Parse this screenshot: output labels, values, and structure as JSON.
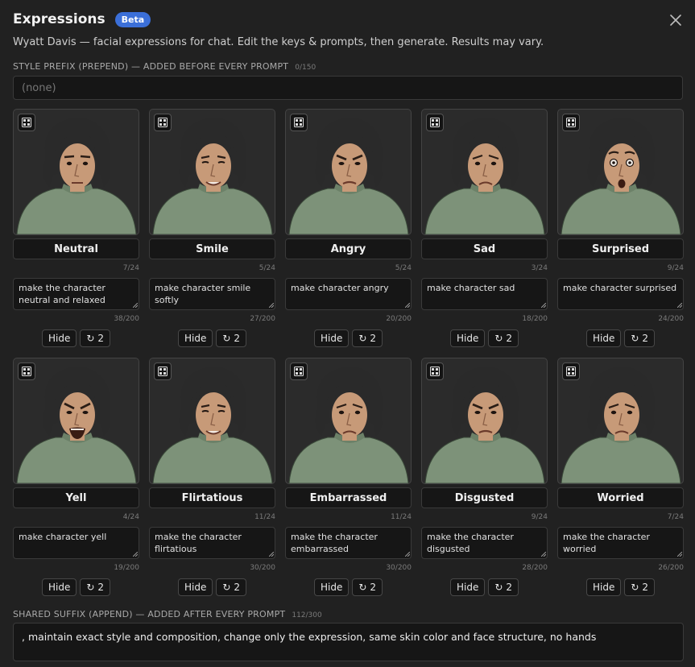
{
  "header": {
    "title": "Expressions",
    "badge": "Beta"
  },
  "subtitle": "Wyatt Davis — facial expressions for chat. Edit the keys & prompts, then generate. Results may vary.",
  "prefix": {
    "label": "STYLE PREFIX (PREPEND) — ADDED BEFORE EVERY PROMPT",
    "count": "0/150",
    "placeholder": "(none)",
    "value": ""
  },
  "suffix": {
    "label": "SHARED SUFFIX (APPEND) — ADDED AFTER EVERY PROMPT",
    "count": "112/300",
    "value": ", maintain exact style and composition, change only the expression, same skin color and face structure, no hands"
  },
  "buttons": {
    "hide": "Hide",
    "regen": "2"
  },
  "icons": {
    "close": "close-icon",
    "generate": "generate-icon",
    "regenerate": "refresh-icon",
    "resize": "resize-grip-icon"
  },
  "colors": {
    "background": "#212121",
    "badge": "#3b6fd8",
    "sweater": "#7d9279",
    "hair": "#2a2a2a",
    "skin": "#c79a78"
  },
  "expressions": [
    {
      "key": "Neutral",
      "key_count": "7/24",
      "prompt": "make the character neutral and relaxed",
      "prompt_count": "38/200",
      "face": "neutral"
    },
    {
      "key": "Smile",
      "key_count": "5/24",
      "prompt": "make character smile softly",
      "prompt_count": "27/200",
      "face": "smile"
    },
    {
      "key": "Angry",
      "key_count": "5/24",
      "prompt": "make character angry",
      "prompt_count": "20/200",
      "face": "angry"
    },
    {
      "key": "Sad",
      "key_count": "3/24",
      "prompt": "make character sad",
      "prompt_count": "18/200",
      "face": "sad"
    },
    {
      "key": "Surprised",
      "key_count": "9/24",
      "prompt": "make character surprised",
      "prompt_count": "24/200",
      "face": "surprised"
    },
    {
      "key": "Yell",
      "key_count": "4/24",
      "prompt": "make character yell",
      "prompt_count": "19/200",
      "face": "yell"
    },
    {
      "key": "Flirtatious",
      "key_count": "11/24",
      "prompt": "make the character flirtatious",
      "prompt_count": "30/200",
      "face": "smile"
    },
    {
      "key": "Embarrassed",
      "key_count": "11/24",
      "prompt": "make the character embarrassed",
      "prompt_count": "30/200",
      "face": "sad"
    },
    {
      "key": "Disgusted",
      "key_count": "9/24",
      "prompt": "make the character disgusted",
      "prompt_count": "28/200",
      "face": "angry"
    },
    {
      "key": "Worried",
      "key_count": "7/24",
      "prompt": "make the character worried",
      "prompt_count": "26/200",
      "face": "sad"
    }
  ]
}
